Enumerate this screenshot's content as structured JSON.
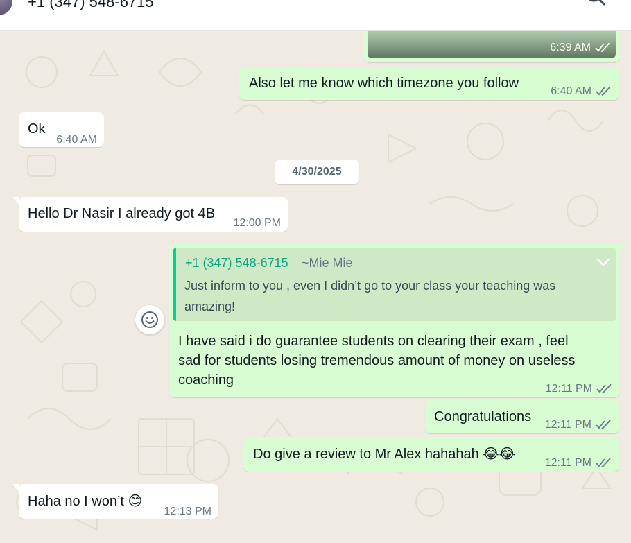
{
  "header": {
    "contact_name": "+1 (347) 548-6715",
    "search_icon": "search-icon"
  },
  "messages": [
    {
      "id": "m0",
      "direction": "outgoing",
      "type": "image",
      "time": "6:39 AM",
      "status": "read"
    },
    {
      "id": "m1",
      "direction": "outgoing",
      "text": "Also let me know which  timezone you follow",
      "time": "6:40 AM",
      "status": "read"
    },
    {
      "id": "m2",
      "direction": "incoming",
      "text": "Ok",
      "time": "6:40 AM"
    },
    {
      "id": "m3",
      "direction": "incoming",
      "text": "Hello Dr Nasir I already got 4B",
      "time": "12:00 PM"
    },
    {
      "id": "m4",
      "direction": "outgoing",
      "quote": {
        "sender": "+1 (347) 548-6715",
        "alias": "~Mie Mie",
        "text": "Just inform to you , even I didn’t go to your class your teaching was amazing!"
      },
      "text_lines": [
        "I have said i do guarantee students on clearing their exam , feel",
        "sad for students losing tremendous amount of money on useless",
        "coaching"
      ],
      "time": "12:11 PM",
      "status": "read"
    },
    {
      "id": "m5",
      "direction": "outgoing",
      "text": "Congratulations",
      "time": "12:11 PM",
      "status": "read"
    },
    {
      "id": "m6",
      "direction": "outgoing",
      "text": "Do give a review to Mr Alex hahahah",
      "emoji": "😂😂",
      "time": "12:11 PM",
      "status": "read"
    },
    {
      "id": "m7",
      "direction": "incoming",
      "text": "Haha no I won’t",
      "emoji": "😊",
      "time": "12:13 PM"
    }
  ],
  "date_divider": "4/30/2025",
  "colors": {
    "outgoing_bubble": "#d9fdd3",
    "incoming_bubble": "#ffffff",
    "read_ticks": "#53bdeb",
    "quote_accent": "#06cf9c",
    "wallpaper": "#efeae2"
  }
}
